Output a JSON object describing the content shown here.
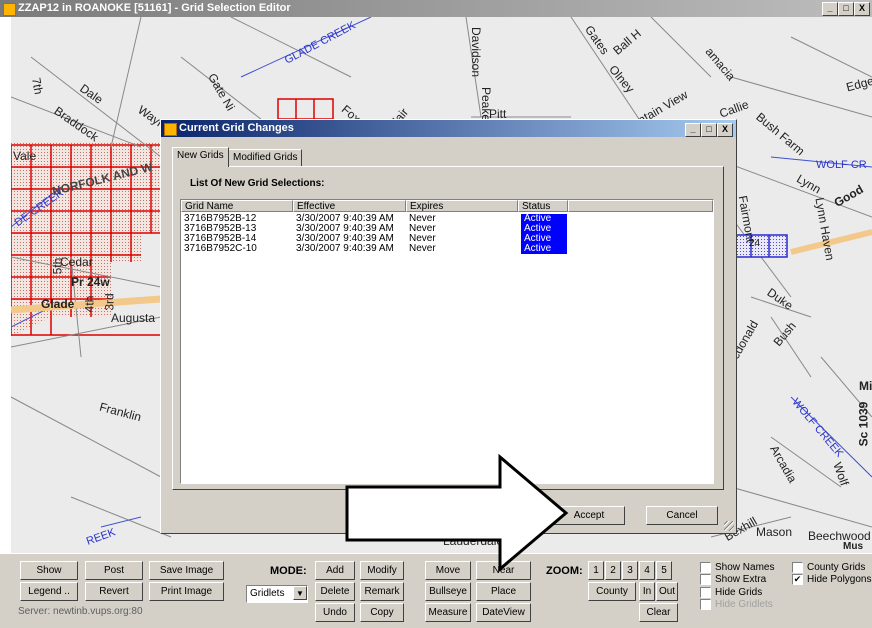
{
  "window": {
    "title": "ZZAP12 in ROANOKE [51161] - Grid Selection Editor",
    "controls": [
      "_",
      "□",
      "X"
    ]
  },
  "map": {
    "labels": {
      "dale": "Dale",
      "braddock": "Braddock",
      "wayne": "Wayne",
      "vale": "Vale",
      "norfolk": "NORFOLK AND W",
      "glade_creek_top": "GLADE CREEK",
      "glade_creek_left": "DE CREEK",
      "fifth": "5th",
      "cedar": "Cedar",
      "pr24w": "Pr 24w",
      "glade": "Glade",
      "fourth": "4th",
      "third": "3rd",
      "augusta": "Augusta",
      "franklin": "Franklin",
      "seventh": "7th",
      "davidson": "Davidson",
      "peake": "Peake",
      "pitt": "Pitt",
      "gates": "Gates",
      "ball": "Ball H",
      "olney": "Olney",
      "mountain_view": "untain View",
      "jamacia": "amacia",
      "callie": "Callie",
      "bush_farm": "Bush Farm",
      "edge": "Edge",
      "wolf_creek_right": "WOLF CR",
      "lynn": "Lynn",
      "lynn_haven": "Lynn Haven",
      "good": "Good",
      "fairmont": "Fairmont",
      "duke": "Duke",
      "mcdonald": "Mcdonald",
      "bush": "Bush",
      "wolf_creek_lower": "WOLF CREEK",
      "arcadia": "Arcadia",
      "wolf": "Wolf",
      "bexhill": "Bexhill",
      "mason": "Mason",
      "beechwood": "Beechwood",
      "mus": "Mus",
      "sc1039": "Sc 1039",
      "mi": "Mi",
      "rt24": "24",
      "creek_bottom": "REEK",
      "lauderdale": "Lauderdale",
      "fox": "Fox",
      "blair": "Blair",
      "gate": "Gate Ni"
    }
  },
  "dialog": {
    "title": "Current Grid Changes",
    "controls": [
      "_",
      "□",
      "X"
    ],
    "tabs": [
      {
        "label": "New Grids",
        "active": true
      },
      {
        "label": "Modified Grids",
        "active": false
      }
    ],
    "list_title": "List Of New Grid Selections:",
    "columns": [
      "Grid Name",
      "Effective",
      "Expires",
      "Status"
    ],
    "rows": [
      {
        "grid_name": "3716B7952B-12",
        "effective": "3/30/2007 9:40:39 AM",
        "expires": "Never",
        "status": "Active"
      },
      {
        "grid_name": "3716B7952B-13",
        "effective": "3/30/2007 9:40:39 AM",
        "expires": "Never",
        "status": "Active"
      },
      {
        "grid_name": "3716B7952B-14",
        "effective": "3/30/2007 9:40:39 AM",
        "expires": "Never",
        "status": "Active"
      },
      {
        "grid_name": "3716B7952C-10",
        "effective": "3/30/2007 9:40:39 AM",
        "expires": "Never",
        "status": "Active"
      }
    ],
    "accept_label": "Accept",
    "cancel_label": "Cancel"
  },
  "toolbar": {
    "show": "Show",
    "post": "Post",
    "save_image": "Save Image",
    "legend": "Legend ..",
    "revert": "Revert",
    "print_image": "Print Image",
    "server": "Server: newtinb.vups.org:80",
    "mode_label": "MODE:",
    "mode_value": "Gridlets",
    "add": "Add",
    "modify": "Modify",
    "delete": "Delete",
    "remark": "Remark",
    "undo": "Undo",
    "copy": "Copy",
    "move": "Move",
    "near": "Near",
    "bullseye": "Bullseye",
    "place": "Place",
    "measure": "Measure",
    "dateview": "DateView",
    "zoom_label": "ZOOM:",
    "zoom_levels": [
      "1",
      "2",
      "3",
      "4",
      "5"
    ],
    "county": "County",
    "zoom_in": "In",
    "zoom_out": "Out",
    "clear": "Clear",
    "checks": {
      "show_names": {
        "label": "Show Names",
        "checked": false
      },
      "show_extra": {
        "label": "Show Extra",
        "checked": false
      },
      "hide_grids": {
        "label": "Hide Grids",
        "checked": false
      },
      "hide_gridlets": {
        "label": "Hide Gridlets",
        "checked": false,
        "disabled": true
      },
      "county_grids": {
        "label": "County Grids",
        "checked": false
      },
      "hide_polygons": {
        "label": "Hide Polygons",
        "checked": true
      }
    }
  },
  "colors": {
    "dialog_title": "#0a246a",
    "status_active": "#0000ff",
    "grid_red": "#e00000",
    "grid_blue": "#2a2ad0",
    "highway": "#f2c98a"
  }
}
